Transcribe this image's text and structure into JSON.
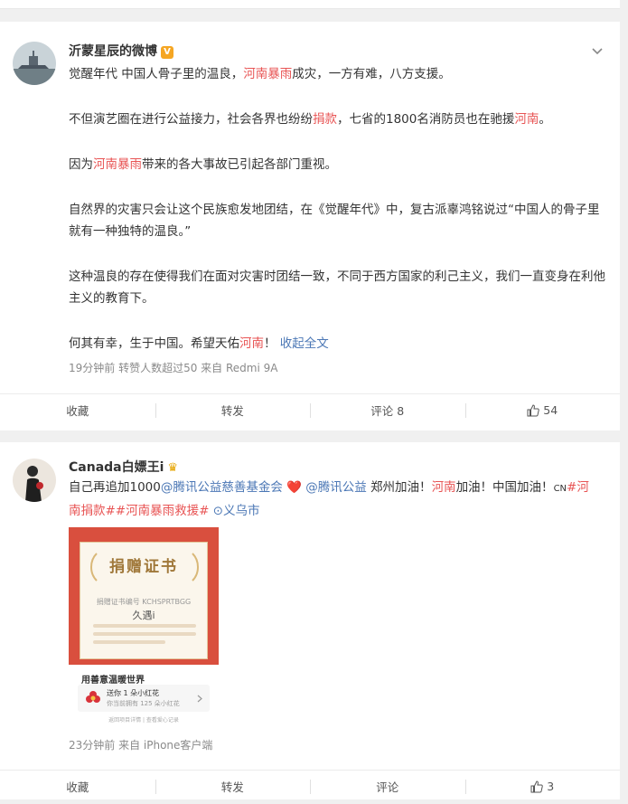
{
  "post1": {
    "author": "沂蒙星辰的微博",
    "badge_icon": "verified-badge-icon",
    "paragraphs": [
      [
        {
          "t": "觉醒年代 中国人骨子里的温良，"
        },
        {
          "t": "河南暴雨",
          "c": "hl"
        },
        {
          "t": "成灾，一方有难，八方支援。"
        }
      ],
      [
        {
          "t": "不但演艺圈在进行公益接力，社会各界也纷纷"
        },
        {
          "t": "捐款",
          "c": "hl"
        },
        {
          "t": "，七省的1800名消防员也在驰援"
        },
        {
          "t": "河南",
          "c": "hl"
        },
        {
          "t": "。"
        }
      ],
      [
        {
          "t": "因为"
        },
        {
          "t": "河南暴雨",
          "c": "hl"
        },
        {
          "t": "带来的各大事故已引起各部门重视。"
        }
      ],
      [
        {
          "t": "自然界的灾害只会让这个民族愈发地团结，在《觉醒年代》中，复古派辜鸿铭说过“中国人的骨子里就有一种独特的温良。”"
        }
      ],
      [
        {
          "t": "这种温良的存在使得我们在面对灾害时团结一致，不同于西方国家的利己主义，我们一直变身在利他主义的教育下。"
        }
      ],
      [
        {
          "t": "何其有幸，生于中国。希望天佑"
        },
        {
          "t": "河南",
          "c": "hl"
        },
        {
          "t": "！ "
        },
        {
          "t": "收起全文",
          "c": "lk"
        }
      ]
    ],
    "meta": "19分钟前  转赞人数超过50  来自 Redmi 9A",
    "actions": {
      "collect": "收藏",
      "repost": "转发",
      "comment": "评论 8",
      "like": "54"
    }
  },
  "post2": {
    "author": "Canada白嫖王i",
    "badge_icon": "crown-emoji-icon",
    "content": [
      {
        "t": "自己再追加1000"
      },
      {
        "t": "@腾讯公益慈善基金会",
        "c": "lk"
      },
      {
        "t": " ❤️ ",
        "c": "hl"
      },
      {
        "t": "@腾讯公益",
        "c": "lk"
      },
      {
        "t": " 郑州加油！"
      },
      {
        "t": "河南",
        "c": "hl"
      },
      {
        "t": "加油！中国加油！"
      },
      {
        "t": "CN",
        "c": "small"
      },
      {
        "t": "#河南捐款##河南暴雨救援#",
        "c": "hl"
      },
      {
        "t": " ⊙义乌市",
        "c": "lk"
      }
    ],
    "image": {
      "title": "捐赠证书",
      "subtitle": "捐赠证书编号 KCHSPRTBGG",
      "name": "久遇i",
      "bottom_title": "用善意温暖世界",
      "row1": "送你 1 朵小红花",
      "row2": "你当前拥有 125 朵小红花",
      "foot": "返回项目详情 | 查看爱心记录"
    },
    "meta": "23分钟前  来自 iPhone客户端",
    "actions": {
      "collect": "收藏",
      "repost": "转发",
      "comment": "评论",
      "like": "3"
    }
  }
}
